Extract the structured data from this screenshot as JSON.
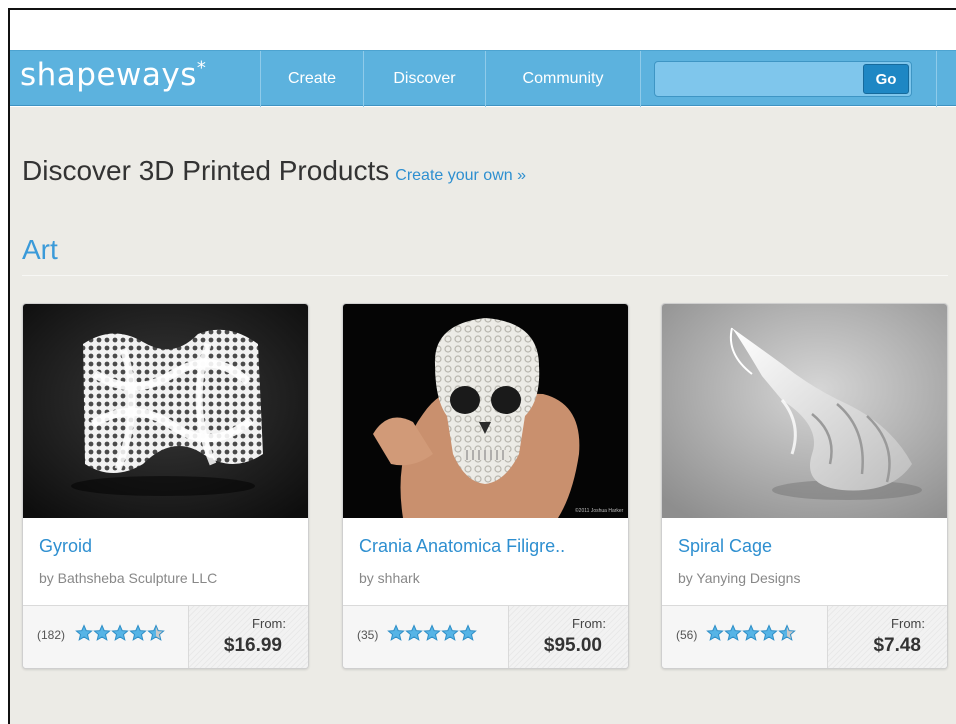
{
  "header": {
    "logo": "shapeways",
    "logo_mark": "*",
    "nav": [
      {
        "label": "Create"
      },
      {
        "label": "Discover"
      },
      {
        "label": "Community"
      }
    ],
    "search": {
      "value": "",
      "placeholder": "",
      "button_label": "Go"
    }
  },
  "page": {
    "title": "Discover 3D Printed Products",
    "create_link": "Create your own »"
  },
  "section": {
    "title": "Art"
  },
  "colors": {
    "topbar": "#5cb2de",
    "accent_link": "#2e8fd0",
    "section_title": "#3a9ad9",
    "star_blue": "#56b4e6",
    "star_grey": "#c9c9c9",
    "go_button": "#1e87c4",
    "background": "#ecebe6"
  },
  "products": [
    {
      "title": "Gyroid",
      "by": "by Bathsheba Sculpture LLC",
      "reviews": "(182)",
      "rating": 4.5,
      "from_label": "From:",
      "price": "$16.99",
      "image": "gyroid-lattice-sculpture"
    },
    {
      "title": "Crania Anatomica Filigre..",
      "by": "by shhark",
      "reviews": "(35)",
      "rating": 5,
      "from_label": "From:",
      "price": "$95.00",
      "image": "filigree-skull-in-hand",
      "image_caption": "©2011 Joshua Harker"
    },
    {
      "title": "Spiral Cage",
      "by": "by Yanying Designs",
      "reviews": "(56)",
      "rating": 4.5,
      "from_label": "From:",
      "price": "$7.48",
      "image": "spiral-cage-sculpture"
    }
  ]
}
